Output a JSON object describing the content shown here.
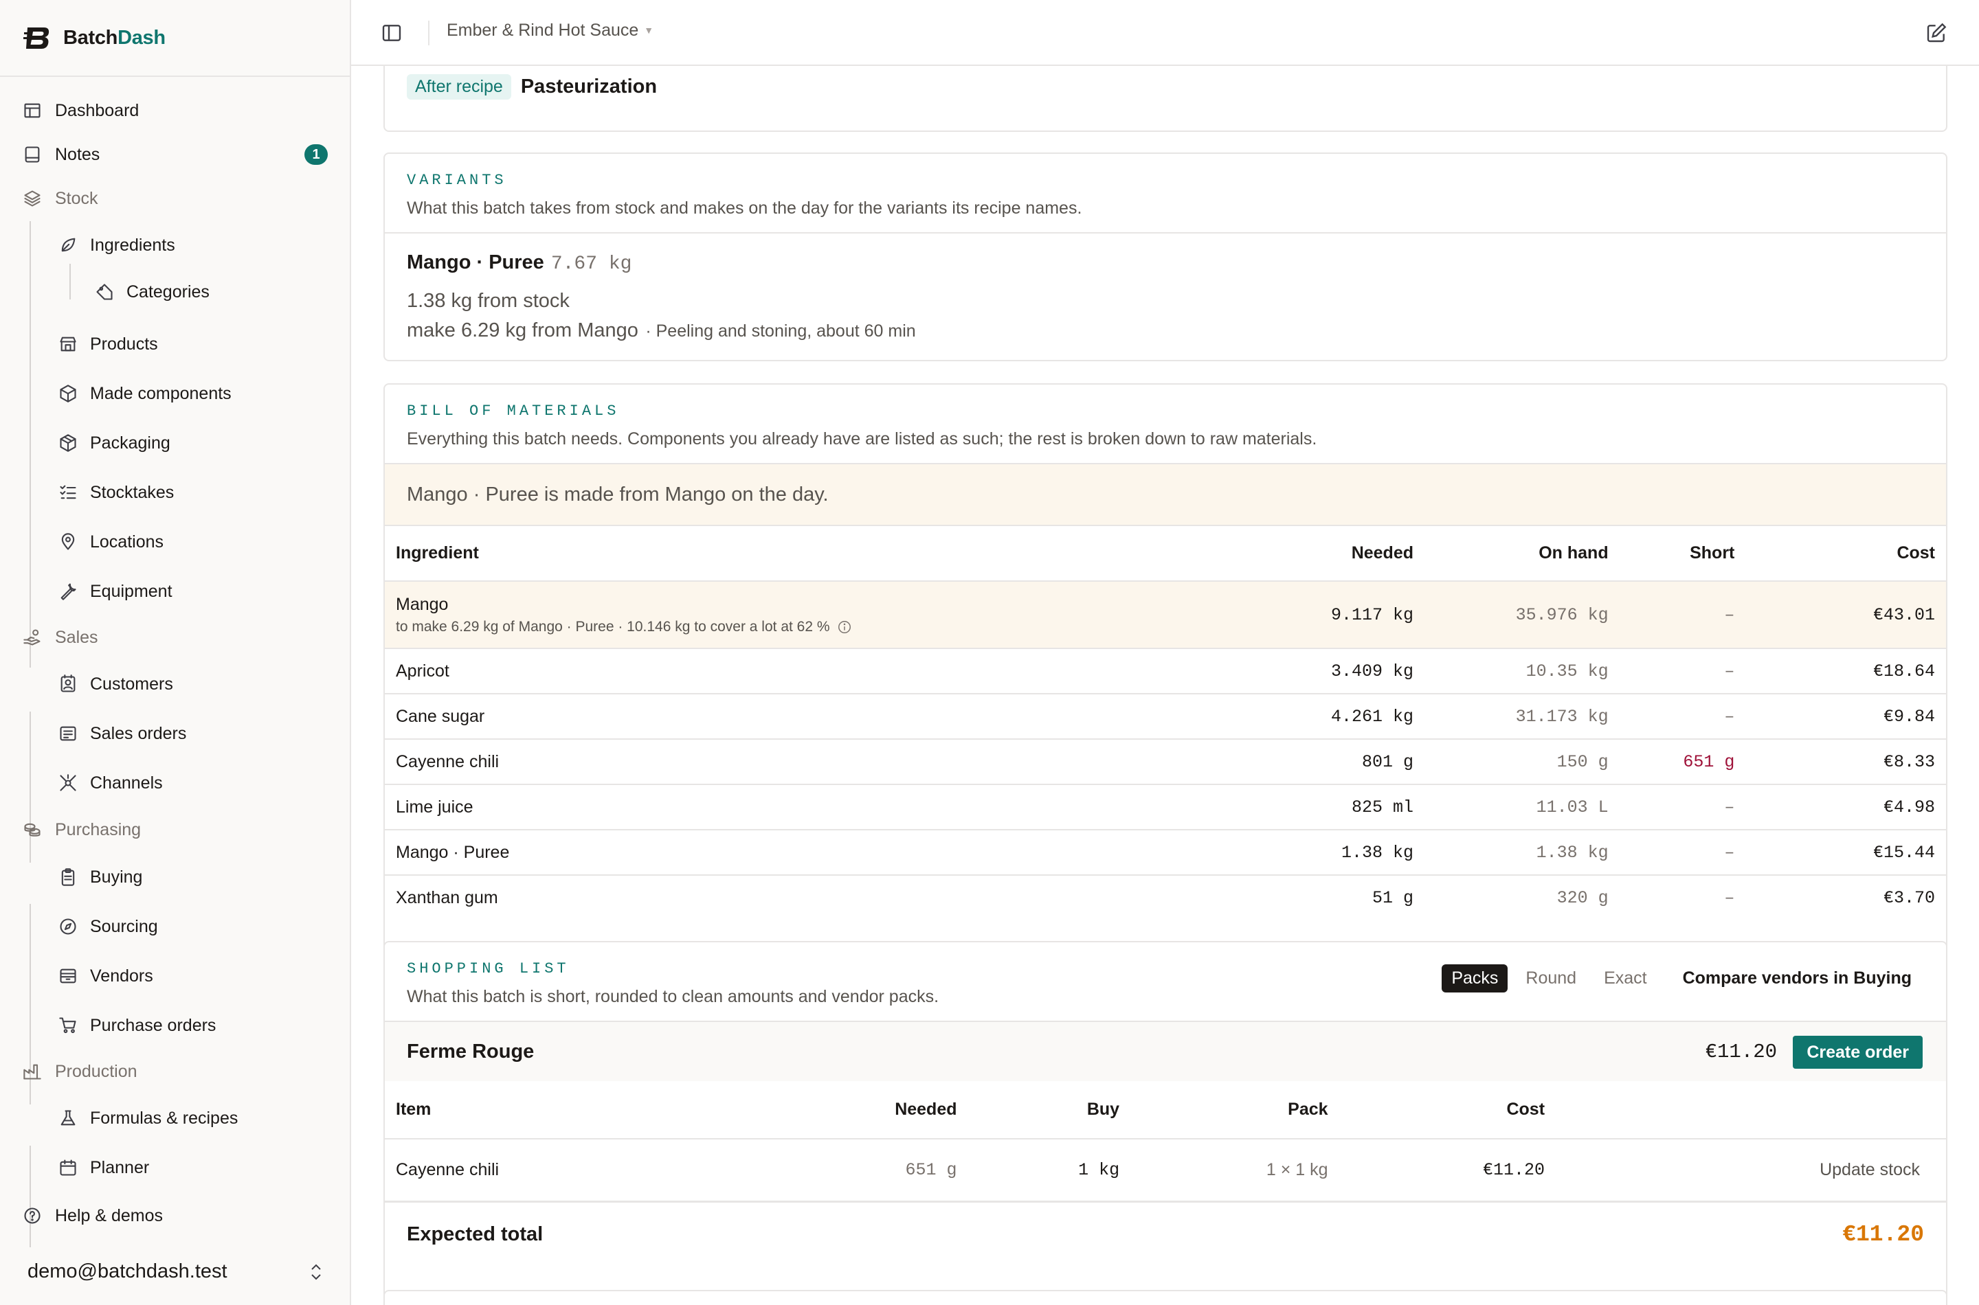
{
  "brand": {
    "name_a": "Batch",
    "name_b": "Dash"
  },
  "sidebar": {
    "items": [
      {
        "label": "Dashboard",
        "icon": "dashboard-icon"
      },
      {
        "label": "Notes",
        "icon": "notes-icon",
        "badge": "1"
      },
      {
        "label": "Stock",
        "icon": "stack-icon"
      },
      {
        "label": "Ingredients",
        "icon": "leaf-icon"
      },
      {
        "label": "Categories",
        "icon": "tag-icon"
      },
      {
        "label": "Products",
        "icon": "shop-icon"
      },
      {
        "label": "Made components",
        "icon": "cube-icon"
      },
      {
        "label": "Packaging",
        "icon": "package-icon"
      },
      {
        "label": "Stocktakes",
        "icon": "checklist-icon"
      },
      {
        "label": "Locations",
        "icon": "pin-icon"
      },
      {
        "label": "Equipment",
        "icon": "wrench-icon"
      },
      {
        "label": "Sales",
        "icon": "hand-coins-icon"
      },
      {
        "label": "Customers",
        "icon": "contact-icon"
      },
      {
        "label": "Sales orders",
        "icon": "receipt-icon"
      },
      {
        "label": "Channels",
        "icon": "network-icon"
      },
      {
        "label": "Purchasing",
        "icon": "coins-icon"
      },
      {
        "label": "Buying",
        "icon": "clipboard-icon"
      },
      {
        "label": "Sourcing",
        "icon": "compass-icon"
      },
      {
        "label": "Vendors",
        "icon": "store-icon"
      },
      {
        "label": "Purchase orders",
        "icon": "cart-icon"
      },
      {
        "label": "Production",
        "icon": "factory-icon"
      },
      {
        "label": "Formulas & recipes",
        "icon": "flask-icon"
      },
      {
        "label": "Planner",
        "icon": "calendar-icon"
      },
      {
        "label": "Help & demos",
        "icon": "help-icon"
      }
    ],
    "user_email": "demo@batchdash.test"
  },
  "topbar": {
    "breadcrumb": "Ember & Rind Hot Sauce"
  },
  "after_recipe": {
    "tag": "After recipe",
    "step": "Pasteurization"
  },
  "variants": {
    "eyebrow": "VARIANTS",
    "description": "What this batch takes from stock and makes on the day for the variants its recipe names.",
    "name": "Mango · Puree",
    "qty": "7.67 kg",
    "from_stock": "1.38 kg from stock",
    "make": "make 6.29 kg from Mango",
    "make_note": "· Peeling and stoning, about 60 min"
  },
  "bom": {
    "eyebrow": "BILL OF MATERIALS",
    "description": "Everything this batch needs. Components you already have are listed as such; the rest is broken down to raw materials.",
    "note": "Mango · Puree is made from Mango on the day.",
    "columns": {
      "ingredient": "Ingredient",
      "needed": "Needed",
      "on_hand": "On hand",
      "short": "Short",
      "cost": "Cost"
    },
    "rows": [
      {
        "ingredient": "Mango",
        "sub": "to make 6.29 kg of Mango · Puree · 10.146 kg to cover a lot at 62 %",
        "needed": "9.117 kg",
        "on_hand": "35.976 kg",
        "short": "–",
        "cost": "€43.01"
      },
      {
        "ingredient": "Apricot",
        "needed": "3.409 kg",
        "on_hand": "10.35 kg",
        "short": "–",
        "cost": "€18.64"
      },
      {
        "ingredient": "Cane sugar",
        "needed": "4.261 kg",
        "on_hand": "31.173 kg",
        "short": "–",
        "cost": "€9.84"
      },
      {
        "ingredient": "Cayenne chili",
        "needed": "801 g",
        "on_hand": "150 g",
        "short": "651 g",
        "cost": "€8.33"
      },
      {
        "ingredient": "Lime juice",
        "needed": "825 ml",
        "on_hand": "11.03 L",
        "short": "–",
        "cost": "€4.98"
      },
      {
        "ingredient": "Mango · Puree",
        "needed": "1.38 kg",
        "on_hand": "1.38 kg",
        "short": "–",
        "cost": "€15.44"
      },
      {
        "ingredient": "Xanthan gum",
        "needed": "51 g",
        "on_hand": "320 g",
        "short": "–",
        "cost": "€3.70"
      }
    ]
  },
  "shopping": {
    "eyebrow": "SHOPPING LIST",
    "description": "What this batch is short, rounded to clean amounts and vendor packs.",
    "modes": [
      "Packs",
      "Round",
      "Exact"
    ],
    "active_mode": "Packs",
    "compare_link": "Compare vendors in Buying",
    "vendor": "Ferme Rouge",
    "vendor_total": "€11.20",
    "create_order": "Create order",
    "columns": {
      "item": "Item",
      "needed": "Needed",
      "buy": "Buy",
      "pack": "Pack",
      "cost": "Cost"
    },
    "rows": [
      {
        "item": "Cayenne chili",
        "needed": "651 g",
        "buy": "1 kg",
        "pack": "1 × 1 kg",
        "cost": "€11.20",
        "action": "Update stock"
      }
    ],
    "expected_total_label": "Expected total",
    "expected_total": "€11.20"
  },
  "colors": {
    "accent": "#0f766e",
    "highlight_row": "#fcf6ec",
    "short_red": "#9f1239",
    "total_orange": "#d97706"
  }
}
